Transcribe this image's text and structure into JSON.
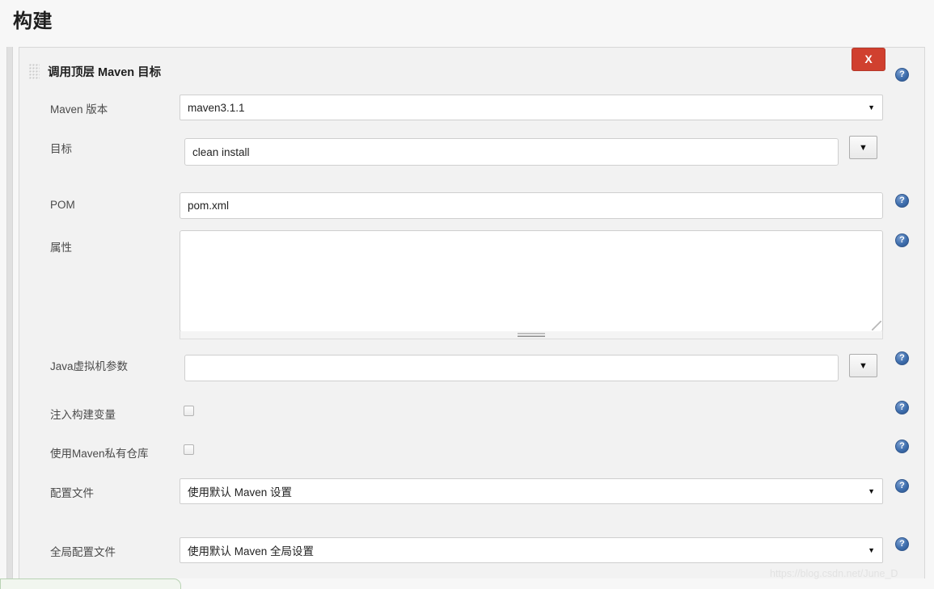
{
  "page": {
    "title": "构建",
    "watermark": "https://blog.csdn.net/June_D"
  },
  "builder": {
    "section_title": "调用顶层 Maven 目标",
    "drag_handle_icon": "drag-grip-icon",
    "delete_label": "X",
    "help_label": "?",
    "caret_glyph": "▼",
    "fields": {
      "maven_version": {
        "label": "Maven 版本",
        "value": "maven3.1.1"
      },
      "goals": {
        "label": "目标",
        "value": "clean install",
        "placeholder": ""
      },
      "pom": {
        "label": "POM",
        "value": "pom.xml",
        "placeholder": ""
      },
      "properties": {
        "label": "属性",
        "value": "",
        "placeholder": ""
      },
      "jvm_options": {
        "label": "Java虚拟机参数",
        "value": "",
        "placeholder": ""
      },
      "inject_build_variables": {
        "label": "注入构建变量",
        "checked": false
      },
      "use_private_repository": {
        "label": "使用Maven私有仓库",
        "checked": false
      },
      "settings_file": {
        "label": "配置文件",
        "value": "使用默认 Maven 设置"
      },
      "global_settings_file": {
        "label": "全局配置文件",
        "value": "使用默认 Maven 全局设置"
      }
    }
  },
  "colors": {
    "delete_button": "#d0402f",
    "help_icon": "#3f6fae",
    "page_background": "#f7f7f7",
    "panel_background": "#f2f2f2"
  }
}
